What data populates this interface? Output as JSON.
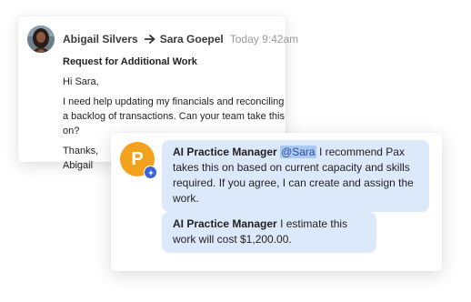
{
  "email": {
    "sender_name": "Abigail Silvers",
    "recipient_name": "Sara Goepel",
    "timestamp": "Today 9:42am",
    "arrow_icon": "arrow-right-icon",
    "avatar": "user-photo-avatar",
    "subject": "Request for Additional Work",
    "greeting": "Hi Sara,",
    "body": "I need help updating my financials and reconciling a backlog of transactions. Can your team take this on?",
    "signoff_line1": "Thanks,",
    "signoff_line2": "Abigail"
  },
  "ai": {
    "avatar_letter": "P",
    "badge_icon": "ai-sparkle-icon",
    "colors": {
      "avatar": "#f3a21d",
      "badge": "#3b63d8",
      "bubble": "#dbe9fb",
      "mention_bg": "#a9c8f2"
    },
    "messages": [
      {
        "author": "AI Practice Manager",
        "mention": "@Sara",
        "text": "I recommend Pax takes this on based on current capacity and skills required. If you agree, I can create and assign the work."
      },
      {
        "author": "AI Practice Manager",
        "text": "I estimate this work will cost $1,200.00."
      }
    ]
  }
}
